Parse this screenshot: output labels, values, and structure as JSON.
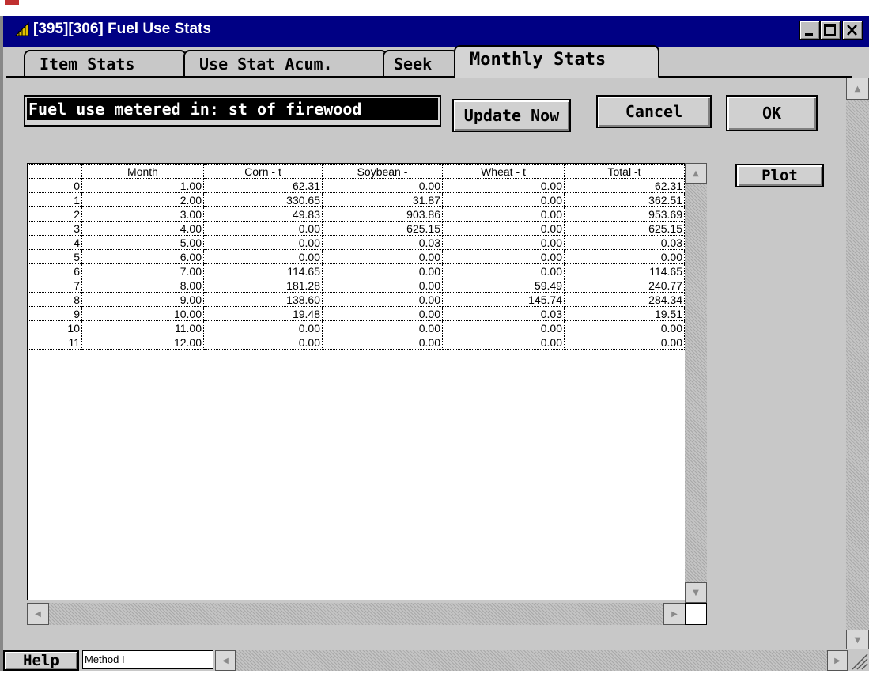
{
  "window": {
    "title": "[395][306]   Fuel Use Stats",
    "minimize_icon": "minimize-icon",
    "maximize_icon": "maximize-icon",
    "close_icon": "close-icon"
  },
  "tabs": [
    {
      "label": "Item Stats",
      "active": false
    },
    {
      "label": "Use Stat Acum.",
      "active": false
    },
    {
      "label": "Seek",
      "active": false
    },
    {
      "label": "Monthly  Stats",
      "active": true
    }
  ],
  "fuel_label": "Fuel use metered in: st of firewood",
  "buttons": {
    "update": "Update Now",
    "cancel": "Cancel",
    "ok": "OK",
    "plot": "Plot",
    "help": "Help"
  },
  "method_field": "Method I",
  "table": {
    "columns": [
      "",
      "Month",
      "Corn - t",
      "Soybean -",
      "Wheat - t",
      "Total -t"
    ],
    "rows": [
      [
        "0",
        "1.00",
        "62.31",
        "0.00",
        "0.00",
        "62.31"
      ],
      [
        "1",
        "2.00",
        "330.65",
        "31.87",
        "0.00",
        "362.51"
      ],
      [
        "2",
        "3.00",
        "49.83",
        "903.86",
        "0.00",
        "953.69"
      ],
      [
        "3",
        "4.00",
        "0.00",
        "625.15",
        "0.00",
        "625.15"
      ],
      [
        "4",
        "5.00",
        "0.00",
        "0.03",
        "0.00",
        "0.03"
      ],
      [
        "5",
        "6.00",
        "0.00",
        "0.00",
        "0.00",
        "0.00"
      ],
      [
        "6",
        "7.00",
        "114.65",
        "0.00",
        "0.00",
        "114.65"
      ],
      [
        "7",
        "8.00",
        "181.28",
        "0.00",
        "59.49",
        "240.77"
      ],
      [
        "8",
        "9.00",
        "138.60",
        "0.00",
        "145.74",
        "284.34"
      ],
      [
        "9",
        "10.00",
        "19.48",
        "0.00",
        "0.03",
        "19.51"
      ],
      [
        "10",
        "11.00",
        "0.00",
        "0.00",
        "0.00",
        "0.00"
      ],
      [
        "11",
        "12.00",
        "0.00",
        "0.00",
        "0.00",
        "0.00"
      ]
    ]
  }
}
